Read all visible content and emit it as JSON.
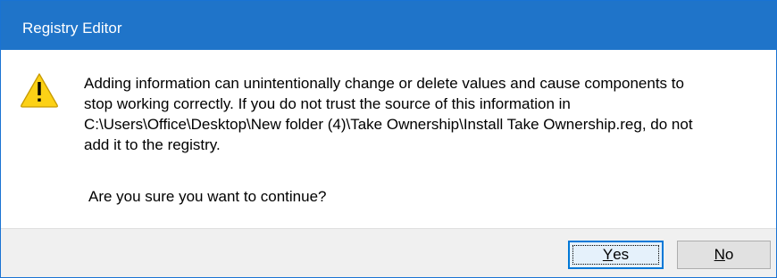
{
  "window": {
    "title": "Registry Editor"
  },
  "dialog": {
    "icon": "warning-icon",
    "message_lines": [
      "Adding information can unintentionally change or delete values and cause components to",
      "stop working correctly. If you do not trust the source of this information in",
      "C:\\Users\\Office\\Desktop\\New folder (4)\\Take Ownership\\Install Take Ownership.reg, do not",
      "add it to the registry."
    ],
    "question": "Are you sure you want to continue?"
  },
  "buttons": {
    "yes": {
      "first": "Y",
      "rest": "es",
      "label": "Yes"
    },
    "no": {
      "first": "N",
      "rest": "o",
      "label": "No"
    }
  },
  "colors": {
    "titlebar": "#1f74c9",
    "footer": "#f0f0f0",
    "focus_border": "#0078d7",
    "warning_yellow": "#fcd116"
  }
}
